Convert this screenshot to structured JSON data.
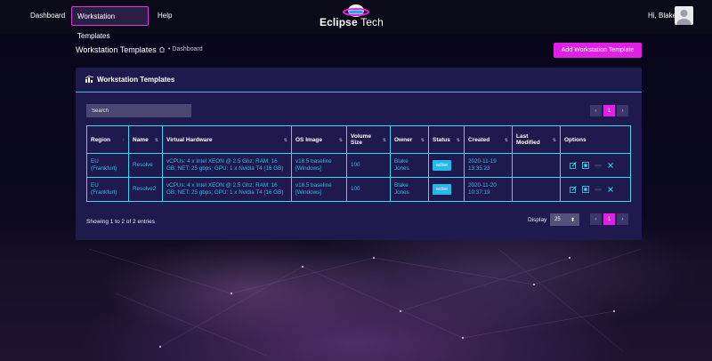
{
  "nav": {
    "links": [
      {
        "label": "Dashboard"
      },
      {
        "label": "Workstation Templates"
      },
      {
        "label": "Help"
      }
    ],
    "brand_main": "Eclipse",
    "brand_thin": "Tech",
    "greeting": "Hi,",
    "user_name": "Blake"
  },
  "page": {
    "title": "Workstation Templates",
    "breadcrumb": "• Dashboard",
    "add_button": "Add Workstation Template"
  },
  "card": {
    "title": "Workstation Templates",
    "search_placeholder": "Search",
    "pager": {
      "prev": "‹",
      "current": "1",
      "next": "›"
    }
  },
  "table": {
    "columns": [
      "Region",
      "Name",
      "Virtual Hardware",
      "OS Image",
      "Volume Size",
      "Owner",
      "Status",
      "Created",
      "Last Modified",
      "Options"
    ],
    "rows": [
      {
        "region": "EU (Frankfurt)",
        "name": "Resolve",
        "hardware": "vCPUs: 4 x Intel XEON @ 2.5 Ghz; RAM: 16 GB; NET: 25 gbps; GPU: 1 x Nvidia T4 (16 GB)",
        "os_image": "v18.5 baseline [Windows]",
        "volume": "100",
        "owner": "Blake Jones",
        "status": "active",
        "created": "2020-11-19 13:35:23",
        "modified": ""
      },
      {
        "region": "EU (Frankfurt)",
        "name": "Resolve2",
        "hardware": "vCPUs: 4 x Intel XEON @ 2.5 Ghz; RAM: 16 GB; NET: 25 gbps; GPU: 1 x Nvidia T4 (16 GB)",
        "os_image": "v18.5 baseline [Windows]",
        "volume": "100",
        "owner": "Blake Jones",
        "status": "active",
        "created": "2020-11-20 10:37:19",
        "modified": ""
      }
    ]
  },
  "footer": {
    "showing": "Showing 1 to 2 of 2 entries",
    "display_label": "Display",
    "display_value": "25"
  },
  "icons": [
    "home-icon",
    "chart-icon",
    "edit-icon",
    "clone-icon",
    "toggle-icon",
    "close-icon",
    "sort-icon",
    "select-caret-icon"
  ],
  "colors": {
    "accent": "#e020e4",
    "cyan": "#3fd3ee",
    "card": "#1e1a4e"
  }
}
